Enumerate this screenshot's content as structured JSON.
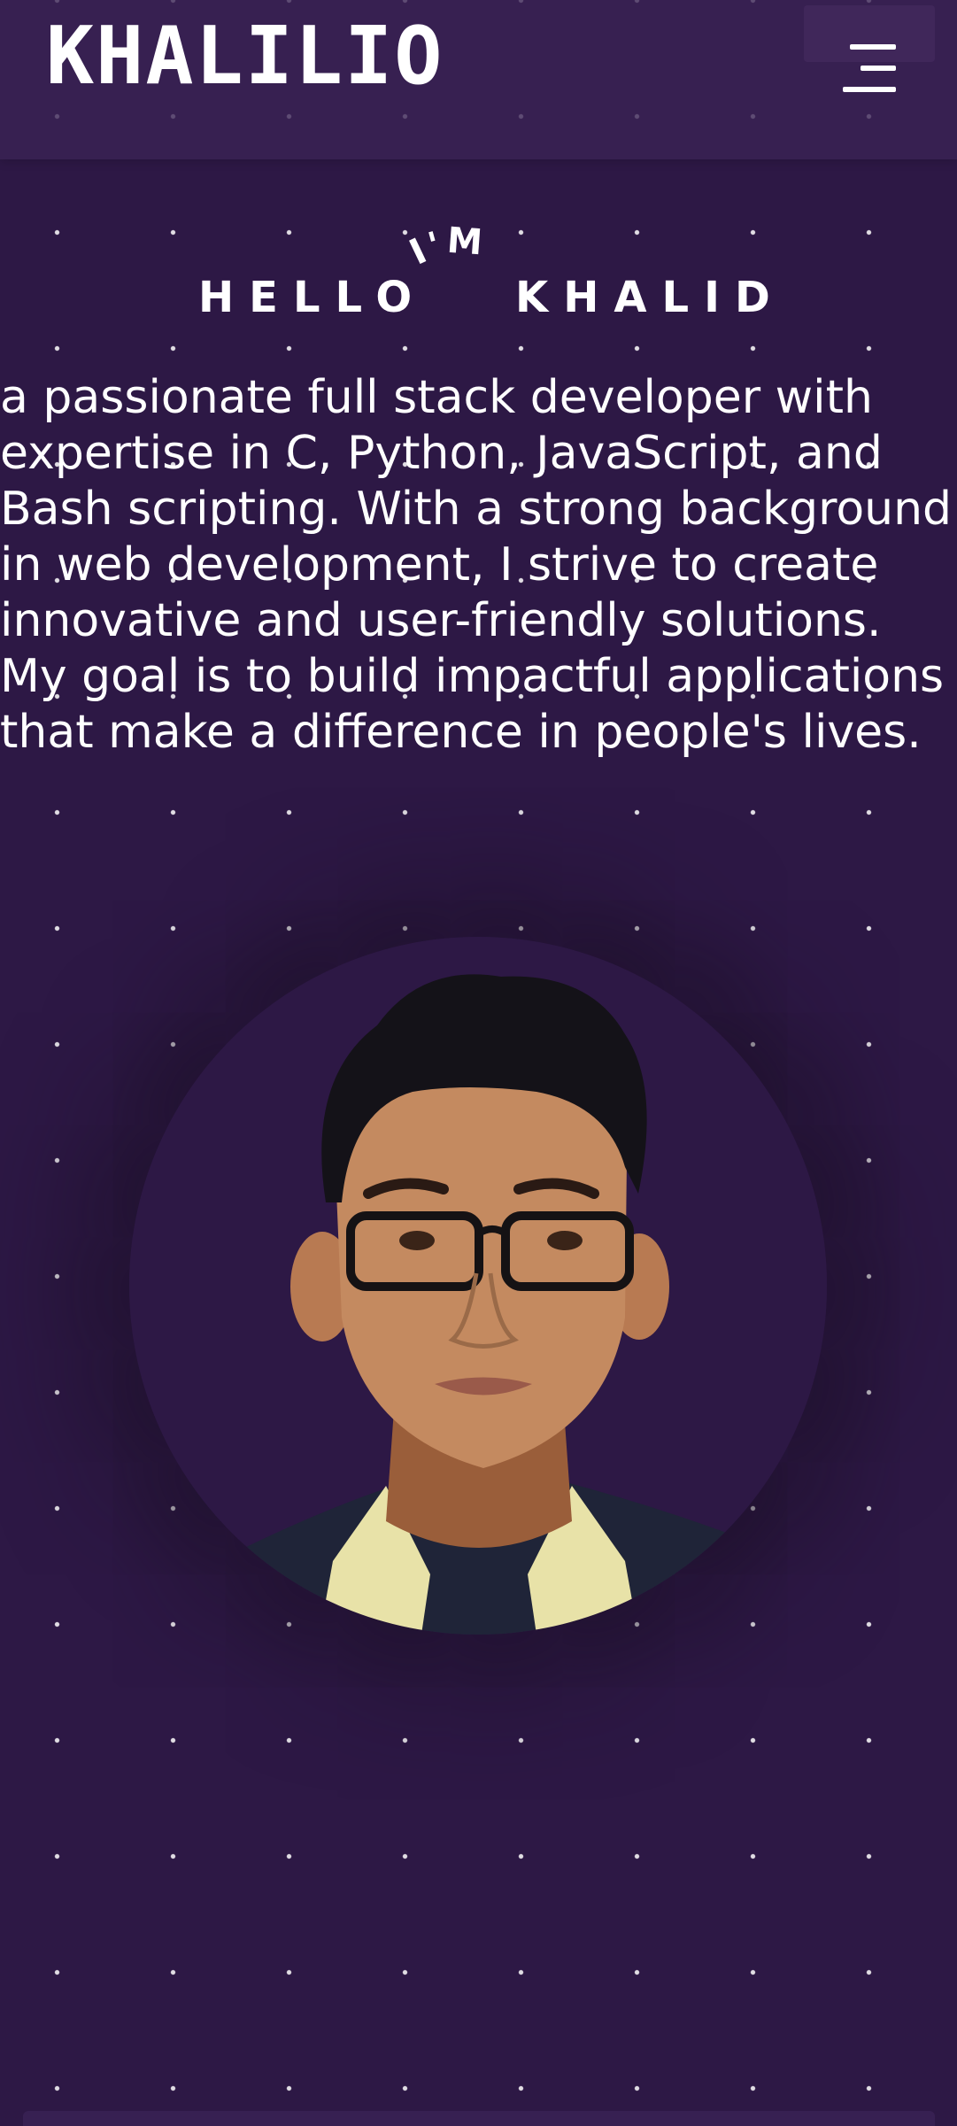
{
  "header": {
    "logo": "KHALILIO",
    "menu_icon": "hamburger-icon"
  },
  "hero": {
    "greeting": "HELLO",
    "im": "I'M",
    "name": "KHALID",
    "bio": "a passionate full stack developer with expertise in C, Python, JavaScript, and Bash scripting. With a strong background in web development, I strive to create innovative and user-friendly solutions. My goal is to build impactful applications that make a difference in people's lives."
  },
  "colors": {
    "background": "#2d1845",
    "header": "#3a2254",
    "text": "#ffffff"
  }
}
